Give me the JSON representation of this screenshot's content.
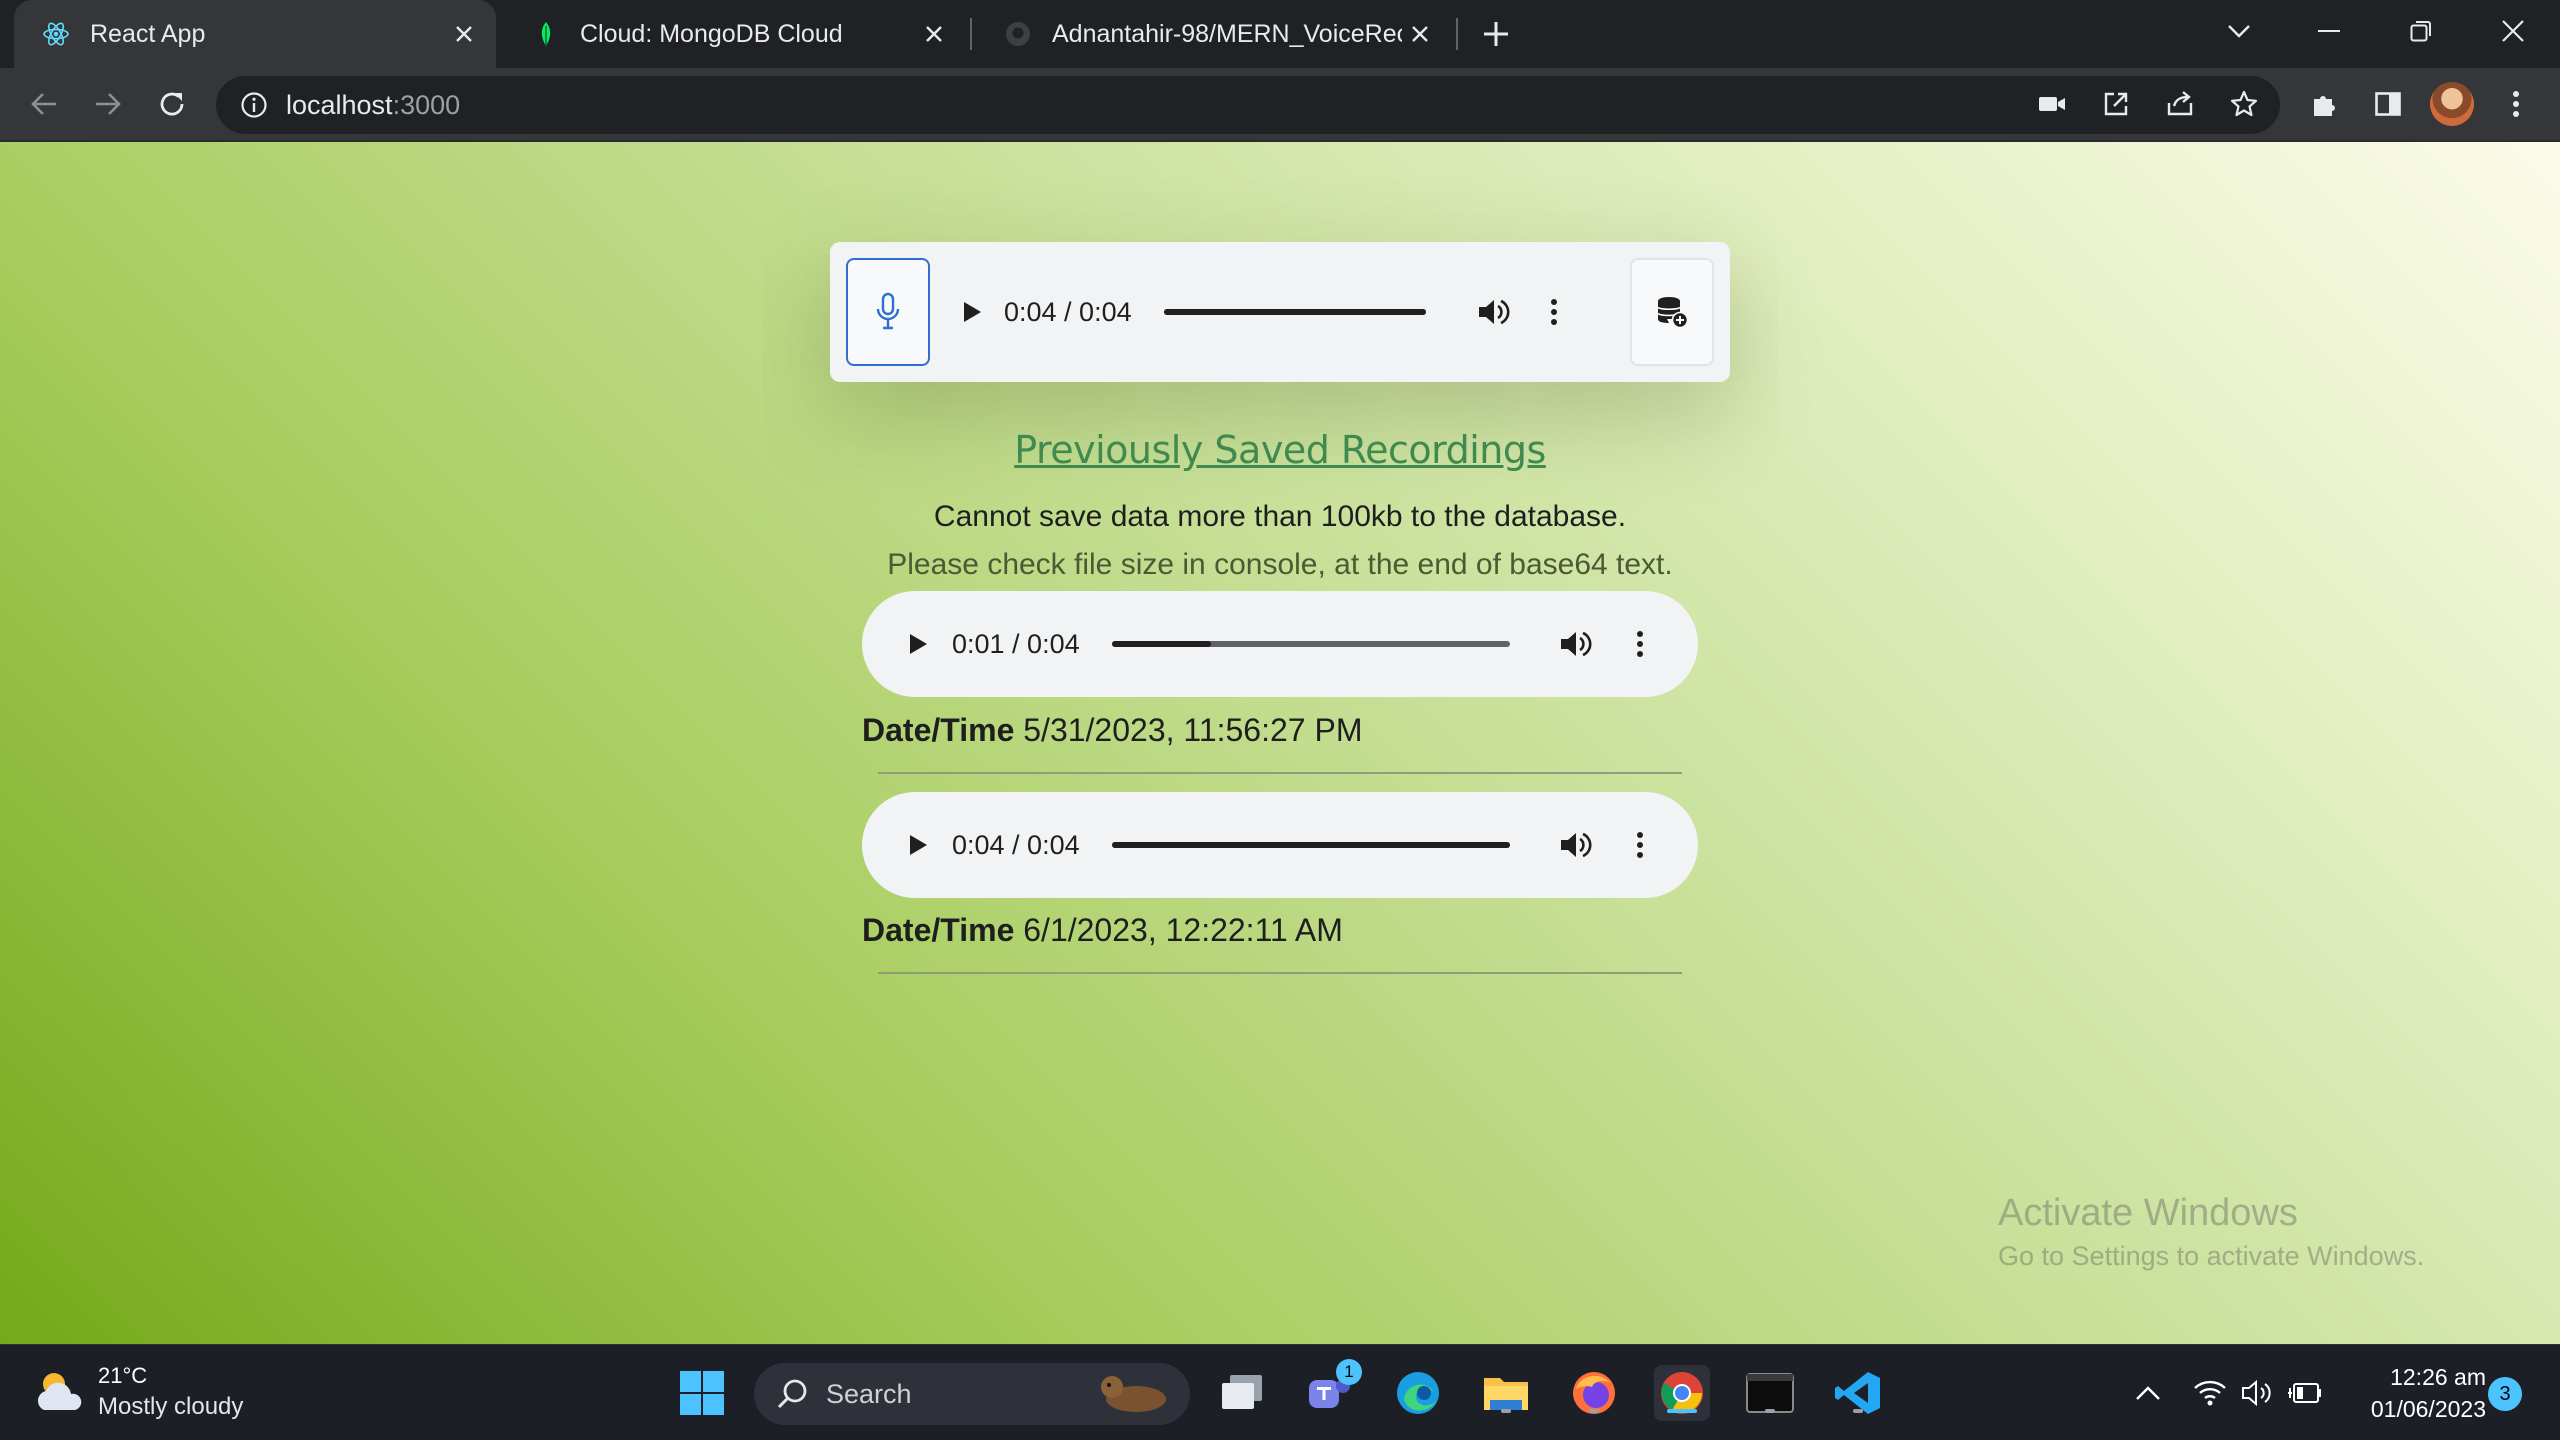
{
  "browser": {
    "tabs": [
      {
        "title": "React App",
        "active": true,
        "favicon": "react-icon"
      },
      {
        "title": "Cloud: MongoDB Cloud",
        "active": false,
        "favicon": "mongodb-leaf-icon"
      },
      {
        "title": "Adnantahir-98/MERN_VoiceRecorder",
        "active": false,
        "favicon": "github-icon"
      }
    ],
    "url_host": "localhost",
    "url_port": ":3000"
  },
  "recorder": {
    "time": "0:04 / 0:04",
    "progress": 1.0
  },
  "saved": {
    "heading": "Previously Saved Recordings",
    "warning_line1": "Cannot save data more than 100kb to the database.",
    "warning_line2": "Please check file size in console, at the end of base64 text.",
    "recordings": [
      {
        "time": "0:01 / 0:04",
        "progress": 0.25,
        "label": "Date/Time",
        "datetime": "5/31/2023, 11:56:27 PM"
      },
      {
        "time": "0:04 / 0:04",
        "progress": 1.0,
        "label": "Date/Time",
        "datetime": "6/1/2023, 12:22:11 AM"
      }
    ]
  },
  "watermark": {
    "title": "Activate Windows",
    "subtitle": "Go to Settings to activate Windows."
  },
  "taskbar": {
    "weather_temp": "21°C",
    "weather_desc": "Mostly cloudy",
    "search_label": "Search",
    "teams_badge": "1",
    "clock_time": "12:26 am",
    "clock_date": "01/06/2023",
    "notification_count": "3"
  },
  "colors": {
    "accent_blue": "#2f6fcf",
    "link_green": "#3f8a4f",
    "taskbar_accent": "#4cc2ff"
  }
}
